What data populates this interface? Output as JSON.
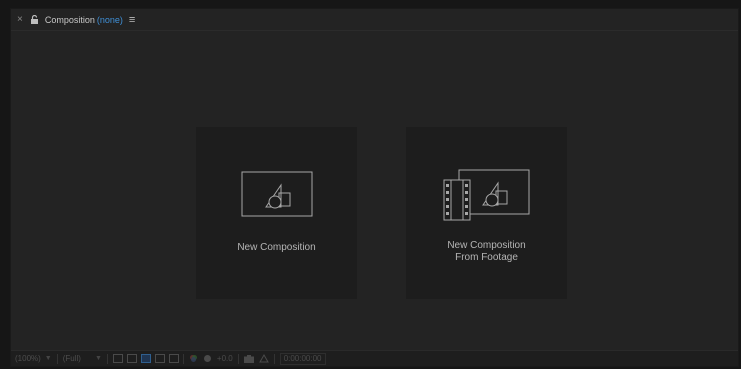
{
  "panel": {
    "close_icon": "×",
    "lock_icon": "lock-icon",
    "title": "Composition",
    "subtitle": "(none)",
    "menu_icon": "≡",
    "accent_color": "#3f8fd6"
  },
  "cards": {
    "new_composition": {
      "label": "New Composition",
      "icon": "composition-icon"
    },
    "new_from_footage": {
      "label_line1": "New Composition",
      "label_line2": "From Footage",
      "icon": "composition-from-footage-icon"
    }
  },
  "toolbar": {
    "magnification": "(100%)",
    "resolution": "(Full)",
    "exposure": "+0.0",
    "timecode": "0:00:00:00"
  }
}
